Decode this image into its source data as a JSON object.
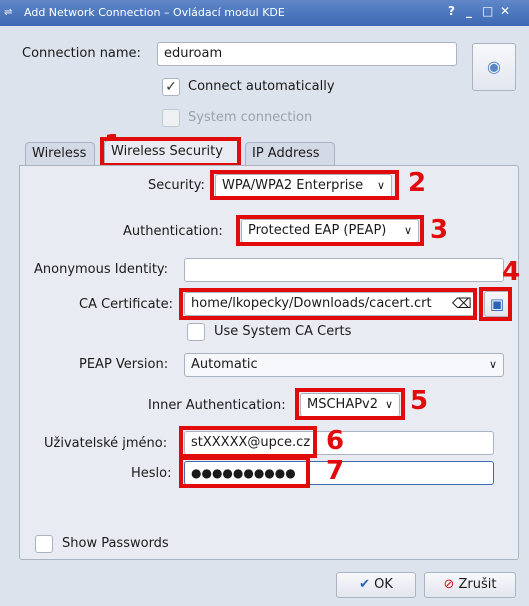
{
  "window": {
    "title": "Add Network Connection – Ovládací modul KDE",
    "controls": [
      "?",
      "_",
      "□",
      "✕"
    ]
  },
  "connection": {
    "name_label": "Connection name:",
    "name_value": "eduroam",
    "connect_auto_label": "Connect automatically",
    "connect_auto_checked": true,
    "system_connection_label": "System connection",
    "system_connection_checked": false
  },
  "tabs": [
    {
      "label": "Wireless",
      "active": false
    },
    {
      "label": "Wireless Security",
      "active": true
    },
    {
      "label": "IP Address",
      "active": false
    }
  ],
  "security": {
    "security_label": "Security:",
    "security_value": "WPA/WPA2 Enterprise",
    "authentication_label": "Authentication:",
    "authentication_value": "Protected EAP (PEAP)",
    "anonymous_identity_label": "Anonymous Identity:",
    "anonymous_identity_value": "",
    "ca_certificate_label": "CA Certificate:",
    "ca_certificate_value": "home/lkopecky/Downloads/cacert.crt",
    "use_system_ca_label": "Use System CA Certs",
    "peap_version_label": "PEAP Version:",
    "peap_version_value": "Automatic",
    "inner_auth_label": "Inner Authentication:",
    "inner_auth_value": "MSCHAPv2",
    "username_label": "Uživatelské jméno:",
    "username_value": "stXXXXX@upce.cz",
    "password_label": "Heslo:",
    "password_value": "●●●●●●●●●●",
    "show_passwords_label": "Show Passwords"
  },
  "buttons": {
    "ok_label": "OK",
    "cancel_label": "Zrušit"
  },
  "annotations": [
    "1",
    "2",
    "3",
    "4",
    "5",
    "6",
    "7"
  ],
  "colors": {
    "annotation_red": "#e10b0b",
    "titlebar_blue": "#4a76bd",
    "window_bg": "#dde3ec"
  }
}
